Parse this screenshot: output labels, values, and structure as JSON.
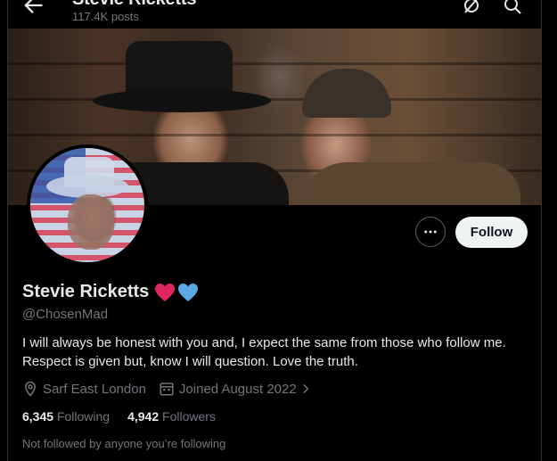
{
  "header": {
    "title": "Stevie Ricketts",
    "posts_count": "117.4K posts"
  },
  "profile": {
    "display_name": "Stevie Ricketts",
    "handle": "@ChosenMad",
    "bio": "I will always be honest with you and, I expect the same from those who follow me. Respect is given but, know I will question. Love the truth.",
    "location": "Sarf East London",
    "joined": "Joined August 2022",
    "following_count": "6,345",
    "following_label": "Following",
    "followers_count": "4,942",
    "followers_label": "Followers",
    "not_followed_note": "Not followed by anyone you’re following"
  },
  "actions": {
    "follow_label": "Follow"
  },
  "icons": {
    "back": "arrow-left-icon",
    "grok": "grok-icon",
    "search": "search-icon",
    "more": "more-horizontal-icon",
    "location": "location-pin-icon",
    "calendar": "calendar-icon",
    "chevron": "chevron-right-icon",
    "red_heart": "red-heart-emoji",
    "blue_heart": "blue-heart-emoji"
  },
  "colors": {
    "background": "#000000",
    "text_primary": "#e7e9ea",
    "text_secondary": "#71767b",
    "follow_button_bg": "#eff3f4",
    "border": "#2f3336",
    "heart_red": "#e0245e",
    "heart_blue": "#5aa9e6"
  }
}
